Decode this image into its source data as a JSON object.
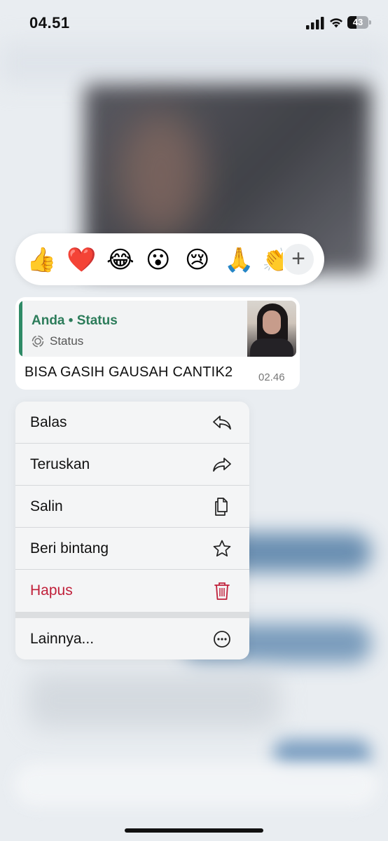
{
  "status_bar": {
    "time": "04.51",
    "battery": "43",
    "battery_level": 0.43
  },
  "reactions": {
    "emojis": [
      {
        "name": "thumbs-up",
        "glyph": "👍"
      },
      {
        "name": "red-heart",
        "glyph": "❤️"
      },
      {
        "name": "tears-of-joy",
        "glyph": "😂"
      },
      {
        "name": "surprised",
        "glyph": "😮"
      },
      {
        "name": "crying",
        "glyph": "😢"
      },
      {
        "name": "folded-hands",
        "glyph": "🙏"
      },
      {
        "name": "clapping-hands",
        "glyph": "👏"
      }
    ],
    "more": "+"
  },
  "message": {
    "quote_title": "Anda • Status",
    "quote_subtitle": "Status",
    "text": "BISA GASIH GAUSAH CANTIK2",
    "time": "02.46"
  },
  "menu": {
    "items": [
      {
        "label": "Balas",
        "icon": "reply-icon"
      },
      {
        "label": "Teruskan",
        "icon": "forward-icon"
      },
      {
        "label": "Salin",
        "icon": "copy-icon"
      },
      {
        "label": "Beri bintang",
        "icon": "star-icon"
      },
      {
        "label": "Hapus",
        "icon": "trash-icon"
      },
      {
        "label": "Lainnya...",
        "icon": "more-icon"
      }
    ]
  },
  "colors": {
    "accent": "#2c7c5a",
    "danger": "#c0203a"
  }
}
